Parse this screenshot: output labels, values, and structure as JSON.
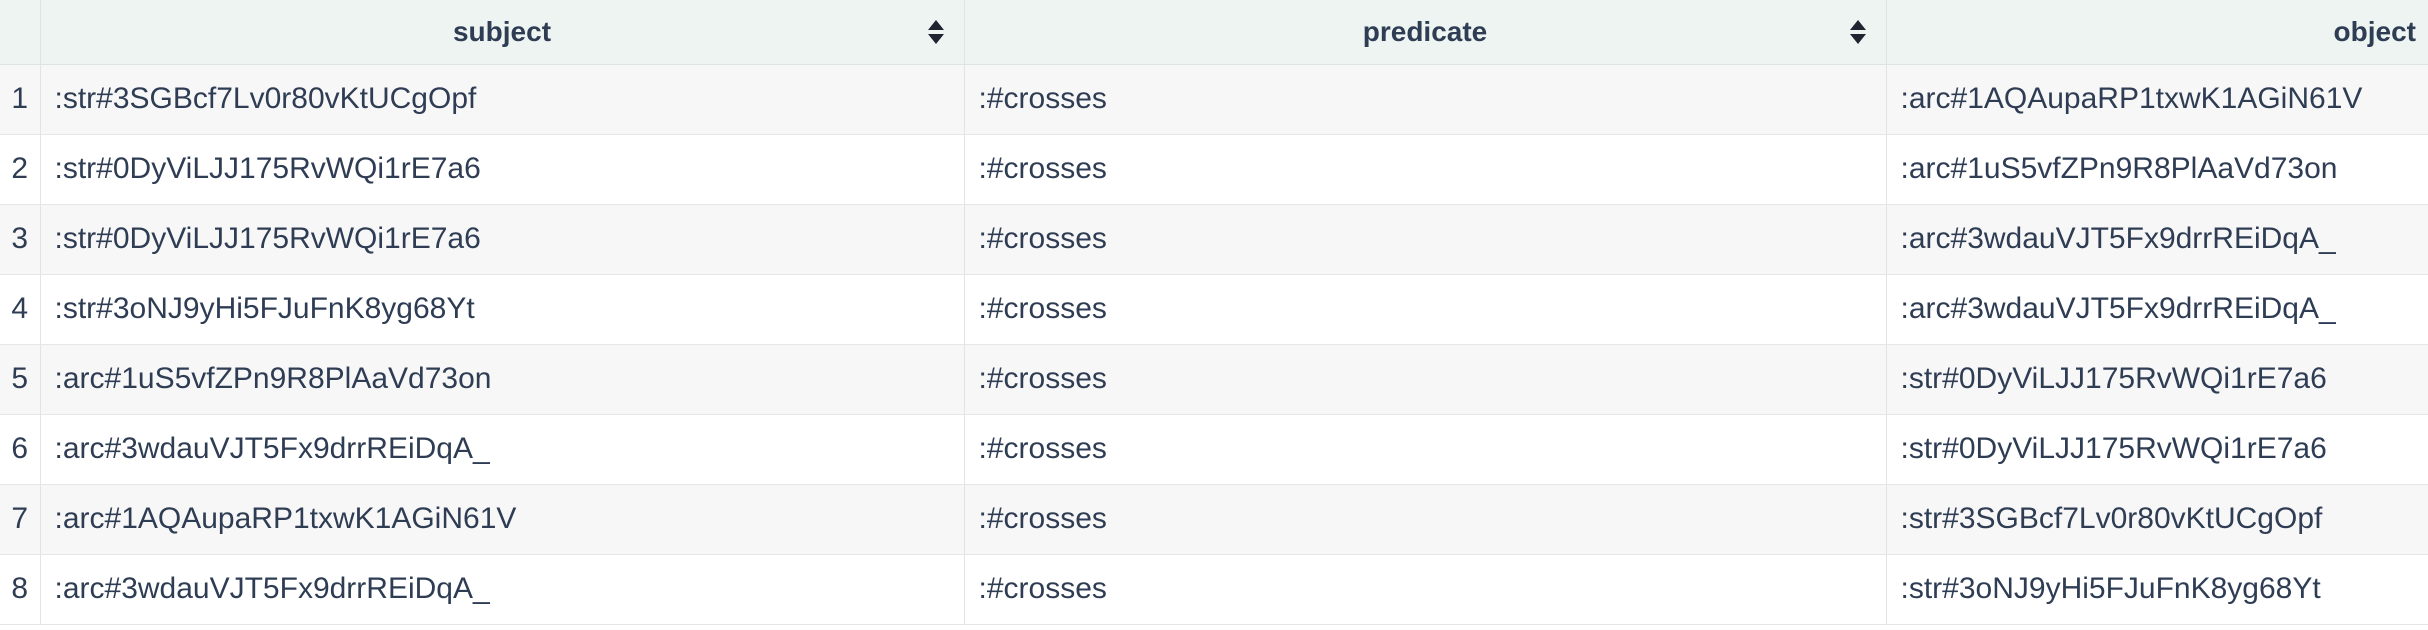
{
  "table": {
    "columns": [
      {
        "label": "",
        "sortable": false
      },
      {
        "label": "subject",
        "sortable": true
      },
      {
        "label": "predicate",
        "sortable": true
      },
      {
        "label": "object",
        "sortable": false
      }
    ],
    "rows": [
      {
        "num": "1",
        "subject": ":str#3SGBcf7Lv0r80vKtUCgOpf",
        "predicate": ":#crosses",
        "object": ":arc#1AQAupaRP1txwK1AGiN61V"
      },
      {
        "num": "2",
        "subject": ":str#0DyViLJJ175RvWQi1rE7a6",
        "predicate": ":#crosses",
        "object": ":arc#1uS5vfZPn9R8PlAaVd73on"
      },
      {
        "num": "3",
        "subject": ":str#0DyViLJJ175RvWQi1rE7a6",
        "predicate": ":#crosses",
        "object": ":arc#3wdauVJT5Fx9drrREiDqA_"
      },
      {
        "num": "4",
        "subject": ":str#3oNJ9yHi5FJuFnK8yg68Yt",
        "predicate": ":#crosses",
        "object": ":arc#3wdauVJT5Fx9drrREiDqA_"
      },
      {
        "num": "5",
        "subject": ":arc#1uS5vfZPn9R8PlAaVd73on",
        "predicate": ":#crosses",
        "object": ":str#0DyViLJJ175RvWQi1rE7a6"
      },
      {
        "num": "6",
        "subject": ":arc#3wdauVJT5Fx9drrREiDqA_",
        "predicate": ":#crosses",
        "object": ":str#0DyViLJJ175RvWQi1rE7a6"
      },
      {
        "num": "7",
        "subject": ":arc#1AQAupaRP1txwK1AGiN61V",
        "predicate": ":#crosses",
        "object": ":str#3SGBcf7Lv0r80vKtUCgOpf"
      },
      {
        "num": "8",
        "subject": ":arc#3wdauVJT5Fx9drrREiDqA_",
        "predicate": ":#crosses",
        "object": ":str#3oNJ9yHi5FJuFnK8yg68Yt"
      }
    ]
  },
  "icons": {
    "sort": "sort-icon"
  },
  "colors": {
    "header_bg": "#eef4f2",
    "odd_row_bg": "#f7f7f7",
    "even_row_bg": "#ffffff",
    "text": "#2f3d54"
  }
}
